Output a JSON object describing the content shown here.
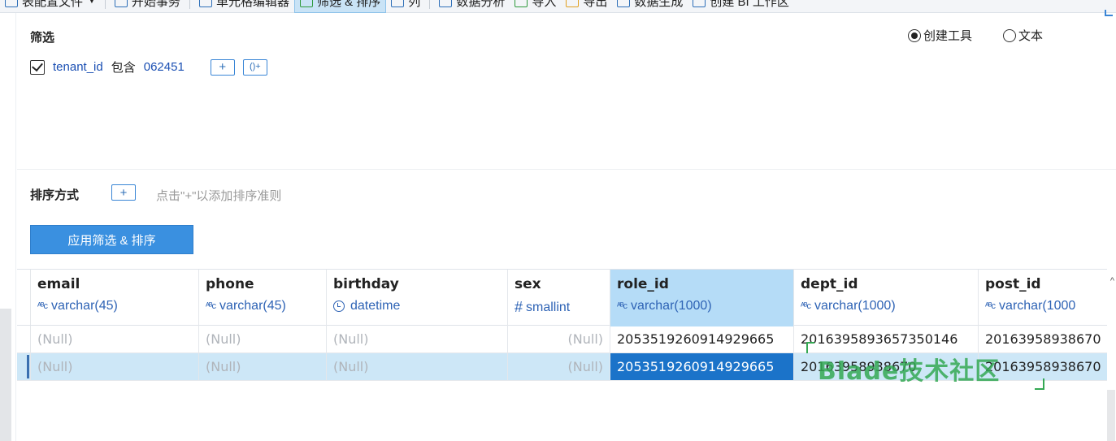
{
  "toolbar": {
    "items": [
      {
        "label": "表配置文件",
        "icon": "table-config-icon",
        "dropdown": true
      },
      {
        "label": "开始事务",
        "icon": "transaction-icon"
      },
      {
        "label": "单元格编辑器",
        "icon": "cell-editor-icon"
      },
      {
        "label": "筛选 & 排序",
        "icon": "filter-sort-icon",
        "active": true
      },
      {
        "label": "列",
        "icon": "columns-icon"
      },
      {
        "label": "数据分析",
        "icon": "data-analysis-icon"
      },
      {
        "label": "导入",
        "icon": "import-icon"
      },
      {
        "label": "导出",
        "icon": "export-icon"
      },
      {
        "label": "数据生成",
        "icon": "data-generation-icon"
      },
      {
        "label": "创建 BI 工作区",
        "icon": "bi-workspace-icon"
      }
    ]
  },
  "filter": {
    "title": "筛选",
    "mode_options": [
      {
        "label": "创建工具",
        "selected": true
      },
      {
        "label": "文本",
        "selected": false
      }
    ],
    "rule": {
      "field": "tenant_id",
      "operator": "包含",
      "value": "062451",
      "checked": true
    },
    "add_symbol": "+",
    "add_group_symbol": "()+"
  },
  "sort": {
    "title": "排序方式",
    "add_symbol": "+",
    "hint": "点击\"+\"以添加排序准则"
  },
  "apply_label": "应用筛选 & 排序",
  "grid": {
    "columns": [
      {
        "name": "email",
        "type": "varchar(45)",
        "type_icon": "text-type-icon"
      },
      {
        "name": "phone",
        "type": "varchar(45)",
        "type_icon": "text-type-icon"
      },
      {
        "name": "birthday",
        "type": "datetime",
        "type_icon": "clock-icon"
      },
      {
        "name": "sex",
        "type": "smallint",
        "type_icon": "number-type-icon"
      },
      {
        "name": "role_id",
        "type": "varchar(1000)",
        "type_icon": "text-type-icon",
        "selected": true
      },
      {
        "name": "dept_id",
        "type": "varchar(1000)",
        "type_icon": "text-type-icon"
      },
      {
        "name": "post_id",
        "type": "varchar(1000",
        "type_icon": "text-type-icon"
      }
    ],
    "rows": [
      [
        "(Null)",
        "(Null)",
        "(Null)",
        "(Null)",
        "2053519260914929665",
        "2016395893657350146",
        "20163958938670"
      ],
      [
        "(Null)",
        "(Null)",
        "(Null)",
        "(Null)",
        "2053519260914929665",
        "20163958938670",
        "20163958938670"
      ]
    ]
  },
  "watermark": "Blade技术社区",
  "colors": {
    "accent": "#3a90e0",
    "selected_column": "#b5dcf7",
    "active_cell": "#1b73c9",
    "highlight_row": "#cde7f7",
    "watermark": "#34a853"
  }
}
